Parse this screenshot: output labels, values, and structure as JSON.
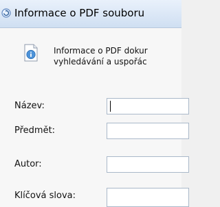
{
  "window": {
    "title": "Informace o PDF souboru",
    "app_icon": "circular-arrow-icon"
  },
  "intro": {
    "icon": "info-icon",
    "line1": "Informace o PDF dokur",
    "line2": "vyhledávání a uspořác"
  },
  "form": {
    "fields": [
      {
        "label": "Název:",
        "value": ""
      },
      {
        "label": "Předmět:",
        "value": ""
      },
      {
        "label": "Autor:",
        "value": ""
      },
      {
        "label": "Klíčová slova:",
        "value": ""
      }
    ]
  }
}
